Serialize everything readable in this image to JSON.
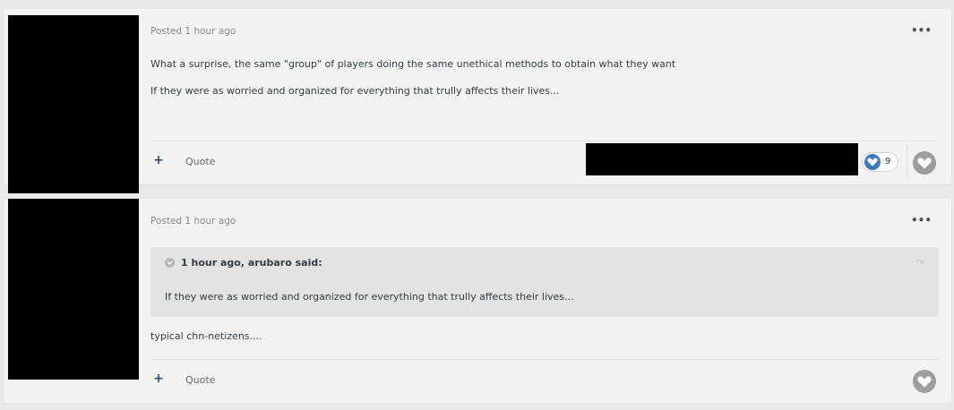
{
  "posts": [
    {
      "meta": "Posted 1 hour ago",
      "more": "•••",
      "lines": [
        "What a surprise, the same \"group\" of players doing the same unethical methods to obtain what they want",
        "If they were as worried and organized for everything that trully affects their lives..."
      ],
      "quote_button": "Quote",
      "plus": "+",
      "reaction_count": "9"
    },
    {
      "meta": "Posted 1 hour ago",
      "more": "•••",
      "quote": {
        "citation": "1 hour ago, arubaro said:",
        "text": "If they were as worried and organized for everything that trully affects their lives...",
        "share_icon": "↷"
      },
      "body": "typical chn-netizens....",
      "quote_button": "Quote",
      "plus": "+"
    }
  ],
  "colors": {
    "background": "#e9e9e9",
    "card": "#f3f3f3",
    "reaction_blue": "#3b7bbf",
    "like_grey": "#9e9e9e"
  },
  "icons": {
    "multiquote": "plus-icon",
    "more": "more-options-icon",
    "reaction": "heart-reaction-icon",
    "like": "heart-like-icon",
    "quote_toggle": "chevron-down-icon",
    "quote_share": "share-arrow-icon"
  }
}
